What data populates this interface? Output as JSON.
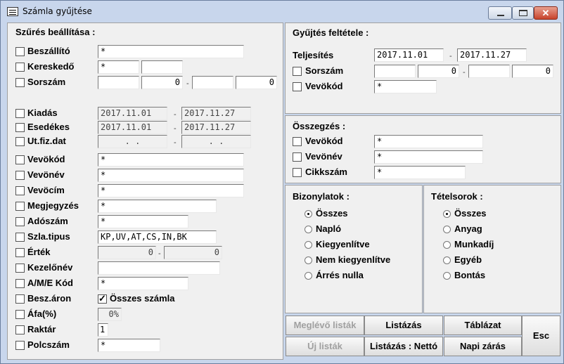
{
  "window": {
    "title": "Számla gyűjtése"
  },
  "filter": {
    "header": "Szűrés beállítása :",
    "rows": {
      "beszallito": {
        "label": "Beszállító",
        "value": "*"
      },
      "keresked": {
        "label": "Kereskedő",
        "value": "*",
        "value2": ""
      },
      "sorszam": {
        "label": "Sorszám",
        "a": "",
        "b": "0",
        "c": "",
        "d": "0"
      },
      "kiadas": {
        "label": "Kiadás",
        "from": "2017.11.01",
        "to": "2017.11.27"
      },
      "esedekes": {
        "label": "Esedékes",
        "from": "2017.11.01",
        "to": "2017.11.27"
      },
      "utfiz": {
        "label": "Ut.fiz.dat",
        "from": "  .  .  ",
        "to": "  .  .  "
      },
      "vevokod": {
        "label": "Vevökód",
        "value": "*"
      },
      "vevonev": {
        "label": "Vevönév",
        "value": "*"
      },
      "vevocim": {
        "label": "Vevöcím",
        "value": "*"
      },
      "megjegyzes": {
        "label": "Megjegyzés",
        "value": "*"
      },
      "adoszam": {
        "label": "Adószám",
        "value": "*"
      },
      "szlatipus": {
        "label": "Szla.tipus",
        "value": "KP,UV,AT,CS,IN,BK"
      },
      "ertek": {
        "label": "Érték",
        "from": "0",
        "to": "0"
      },
      "kezelonev": {
        "label": "Kezelőnév",
        "value": ""
      },
      "amekod": {
        "label": "A/M/E Kód",
        "value": "*"
      },
      "beszaron": {
        "label": "Besz.áron",
        "osszes_label": "Összes számla"
      },
      "afa": {
        "label": "Áfa(%)",
        "value": "0%"
      },
      "raktar": {
        "label": "Raktár",
        "value": "1"
      },
      "polcszam": {
        "label": "Polcszám",
        "value": "*"
      }
    }
  },
  "gyujtes": {
    "header": "Gyűjtés feltétele :",
    "teljesites": {
      "label": "Teljesítés",
      "from": "2017.11.01",
      "to": "2017.11.27"
    },
    "sorszam": {
      "label": "Sorszám",
      "a": "",
      "b": "0",
      "c": "",
      "d": "0"
    },
    "vevokod": {
      "label": "Vevökód",
      "value": "*"
    }
  },
  "osszegzes": {
    "header": "Összegzés :",
    "vevokod": {
      "label": "Vevökód",
      "value": "*"
    },
    "vevonev": {
      "label": "Vevönév",
      "value": "*"
    },
    "cikkszam": {
      "label": "Cikkszám",
      "value": "*"
    }
  },
  "bizonylatok": {
    "header": "Bizonylatok :",
    "options": [
      "Összes",
      "Napló",
      "Kiegyenlítve",
      "Nem kiegyenlítve",
      "Árrés nulla"
    ],
    "selected": "Összes"
  },
  "tetelsorok": {
    "header": "Tételsorok :",
    "options": [
      "Összes",
      "Anyag",
      "Munkadíj",
      "Egyéb",
      "Bontás"
    ],
    "selected": "Összes"
  },
  "buttons": {
    "meglevo": "Meglévő listák",
    "listazas": "Listázás",
    "tablazat": "Táblázat",
    "esc": "Esc",
    "uj": "Új listák",
    "listazas_netto": "Listázás : Nettó",
    "napi_zaras": "Napi zárás"
  }
}
